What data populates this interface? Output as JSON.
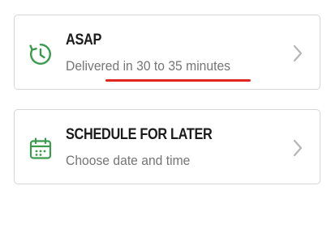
{
  "colors": {
    "icon_green": "#3a9a4e",
    "underline_red": "#e0261e",
    "chevron_gray": "#b5b5b5",
    "border_gray": "#d6d6d6"
  },
  "options": [
    {
      "title": "ASAP",
      "subtitle": "Delivered in 30 to 35 minutes",
      "icon": "clock-refresh-icon",
      "highlighted_text": "30 to 35 minutes"
    },
    {
      "title": "SCHEDULE FOR LATER",
      "subtitle": "Choose date and time",
      "icon": "calendar-icon"
    }
  ]
}
